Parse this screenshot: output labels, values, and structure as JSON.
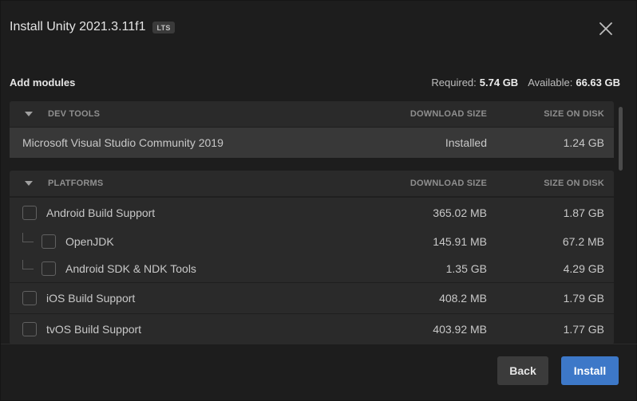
{
  "dialog": {
    "title": "Install Unity 2021.3.11f1",
    "badge": "LTS"
  },
  "header": {
    "add_modules_label": "Add modules",
    "required_label": "Required:",
    "required_value": "5.74 GB",
    "available_label": "Available:",
    "available_value": "66.63 GB"
  },
  "columns": {
    "download_size": "DOWNLOAD SIZE",
    "size_on_disk": "SIZE ON DISK"
  },
  "dev_tools": {
    "group_name": "DEV TOOLS",
    "items": [
      {
        "name": "Microsoft Visual Studio Community 2019",
        "download": "Installed",
        "disk": "1.24 GB"
      }
    ]
  },
  "platforms": {
    "group_name": "PLATFORMS",
    "items": [
      {
        "name": "Android Build Support",
        "download": "365.02 MB",
        "disk": "1.87 GB",
        "checked": false
      },
      {
        "name": "OpenJDK",
        "download": "145.91 MB",
        "disk": "67.2 MB",
        "checked": false
      },
      {
        "name": "Android SDK & NDK Tools",
        "download": "1.35 GB",
        "disk": "4.29 GB",
        "checked": false
      },
      {
        "name": "iOS Build Support",
        "download": "408.2 MB",
        "disk": "1.79 GB",
        "checked": false
      },
      {
        "name": "tvOS Build Support",
        "download": "403.92 MB",
        "disk": "1.77 GB",
        "checked": false
      }
    ]
  },
  "footer": {
    "back_label": "Back",
    "install_label": "Install"
  },
  "icons": {
    "close": "close-icon",
    "caret": "caret-down-icon"
  },
  "colors": {
    "accent": "#3d78c8",
    "background": "#1d1d1d"
  }
}
